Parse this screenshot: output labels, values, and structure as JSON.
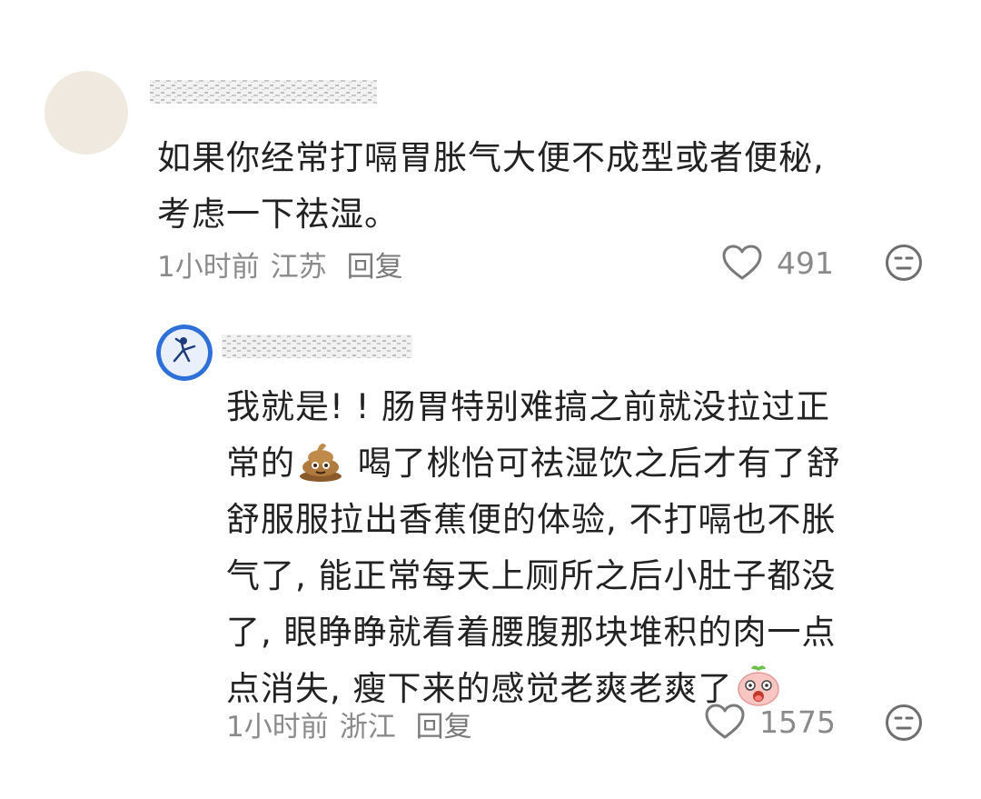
{
  "comments": [
    {
      "lines": [
        "如果你经常打嗝胃胀气大便不成型或者便秘,",
        "考虑一下祛湿。"
      ],
      "time": "1小时前",
      "location": "江苏",
      "reply_label": "回复",
      "likes": "491",
      "avatar_color": "#efe9e0"
    },
    {
      "lines": [
        "我就是! ! 肠胃特别难搞之前就没拉过正",
        "常的",
        "喝了桃怡可祛湿饮之后才有了舒",
        "舒服服拉出香蕉便的体验, 不打嗝也不胀",
        "气了, 能正常每天上厕所之后小肚子都没",
        "了, 眼睁睁就看着腰腹那块堆积的肉一点",
        "点消失, 瘦下来的感觉老爽老爽了"
      ],
      "emoji_1": "poop-emoji",
      "emoji_2": "peach-face-emoji",
      "time": "1小时前",
      "location": "浙江",
      "reply_label": "回复",
      "likes": "1575",
      "avatar_color": "#2f6fd8"
    }
  ],
  "icons": {
    "like": "heart-outline-icon",
    "dislike": "meh-face-icon"
  }
}
